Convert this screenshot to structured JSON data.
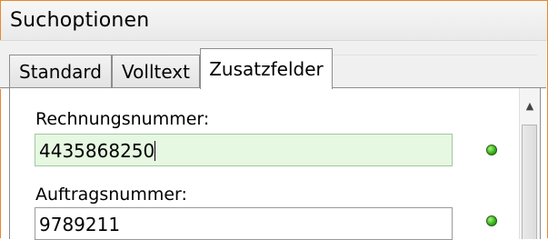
{
  "window": {
    "title": "Suchoptionen"
  },
  "tabs": [
    {
      "label": "Standard",
      "active": false
    },
    {
      "label": "Volltext",
      "active": false
    },
    {
      "label": "Zusatzfelder",
      "active": true
    }
  ],
  "fields": [
    {
      "label": "Rechnungsnummer:",
      "value": "4435868250",
      "focused": true,
      "status": "green"
    },
    {
      "label": "Auftragsnummer:",
      "value": "9789211",
      "focused": false,
      "status": "green"
    }
  ],
  "colors": {
    "frame_accent": "#e8872f",
    "focused_field_bg": "#e6f7e2",
    "status_ok": "#35b51a"
  },
  "icons": {
    "status": "green-status-dot-icon",
    "scroll_up": "scroll-up-arrow-icon"
  }
}
